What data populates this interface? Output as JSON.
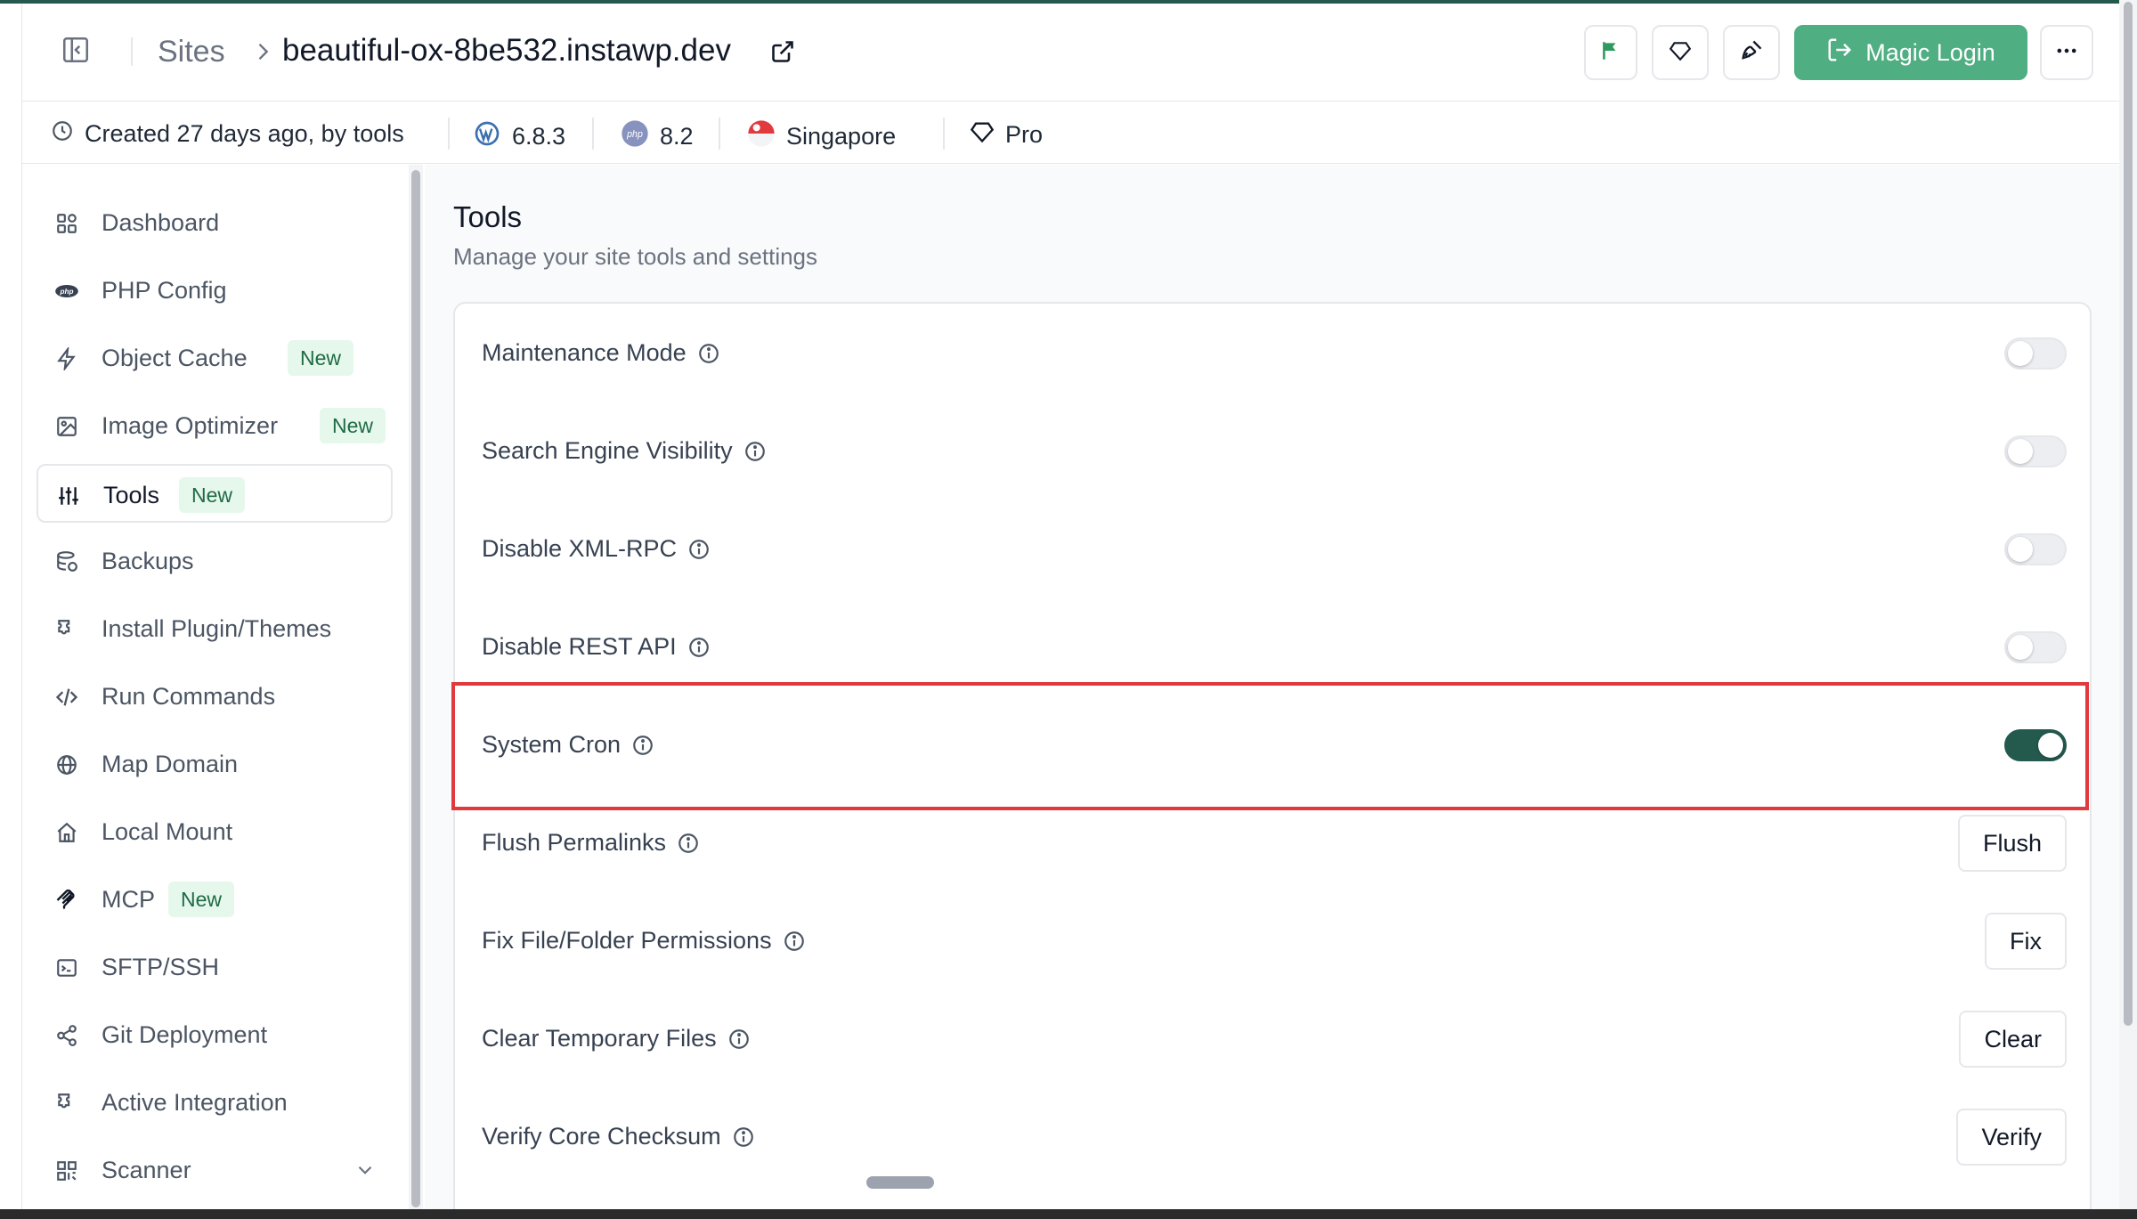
{
  "header": {
    "breadcrumb_root": "Sites",
    "site_name": "beautiful-ox-8be532.instawp.dev",
    "magic_login_label": "Magic Login"
  },
  "meta": {
    "created": "Created 27 days ago, by tools",
    "wp_version": "6.8.3",
    "php_version": "8.2",
    "region": "Singapore",
    "plan": "Pro"
  },
  "sidebar": {
    "items": [
      {
        "label": "Dashboard",
        "icon": "dashboard-icon"
      },
      {
        "label": "PHP Config",
        "icon": "php-icon"
      },
      {
        "label": "Object Cache",
        "icon": "bolt-icon",
        "badge": "New"
      },
      {
        "label": "Image Optimizer",
        "icon": "image-icon",
        "badge": "New"
      },
      {
        "label": "Tools",
        "icon": "sliders-icon",
        "badge": "New",
        "active": true
      },
      {
        "label": "Backups",
        "icon": "database-icon"
      },
      {
        "label": "Install Plugin/Themes",
        "icon": "puzzle-icon"
      },
      {
        "label": "Run Commands",
        "icon": "code-icon"
      },
      {
        "label": "Map Domain",
        "icon": "globe-icon"
      },
      {
        "label": "Local Mount",
        "icon": "home-icon"
      },
      {
        "label": "MCP",
        "icon": "mcp-icon",
        "badge": "New"
      },
      {
        "label": "SFTP/SSH",
        "icon": "terminal-icon"
      },
      {
        "label": "Git Deployment",
        "icon": "share-icon"
      },
      {
        "label": "Active Integration",
        "icon": "puzzle-icon"
      },
      {
        "label": "Scanner",
        "icon": "qr-icon"
      }
    ]
  },
  "main": {
    "title": "Tools",
    "subtitle": "Manage your site tools and settings",
    "rows": [
      {
        "label": "Maintenance Mode",
        "control": "toggle",
        "on": false
      },
      {
        "label": "Search Engine Visibility",
        "control": "toggle",
        "on": false
      },
      {
        "label": "Disable XML-RPC",
        "control": "toggle",
        "on": false
      },
      {
        "label": "Disable REST API",
        "control": "toggle",
        "on": false
      },
      {
        "label": "System Cron",
        "control": "toggle",
        "on": true
      },
      {
        "label": "Flush Permalinks",
        "control": "button",
        "button": "Flush"
      },
      {
        "label": "Fix File/Folder Permissions",
        "control": "button",
        "button": "Fix"
      },
      {
        "label": "Clear Temporary Files",
        "control": "button",
        "button": "Clear"
      },
      {
        "label": "Verify Core Checksum",
        "control": "button",
        "button": "Verify"
      }
    ]
  },
  "colors": {
    "accent": "#24594e",
    "magic_login": "#4fae82",
    "badge_bg": "#e6f7ec",
    "highlight": "#e0393e"
  }
}
